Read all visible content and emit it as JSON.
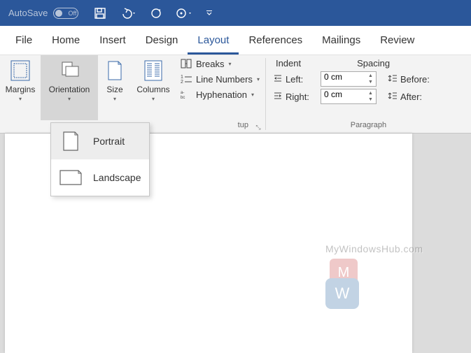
{
  "titlebar": {
    "autosave_label": "AutoSave",
    "autosave_state": "Off"
  },
  "tabs": [
    "File",
    "Home",
    "Insert",
    "Design",
    "Layout",
    "References",
    "Mailings",
    "Review"
  ],
  "active_tab": "Layout",
  "page_setup": {
    "margins": "Margins",
    "orientation": "Orientation",
    "size": "Size",
    "columns": "Columns",
    "breaks": "Breaks",
    "line_numbers": "Line Numbers",
    "hyphenation": "Hyphenation",
    "group_label": "tup"
  },
  "paragraph": {
    "indent_head": "Indent",
    "spacing_head": "Spacing",
    "left_label": "Left:",
    "right_label": "Right:",
    "before_label": "Before:",
    "after_label": "After:",
    "left_value": "0 cm",
    "right_value": "0 cm",
    "group_label": "Paragraph"
  },
  "orientation_menu": {
    "portrait": "Portrait",
    "landscape": "Landscape"
  },
  "watermark_text": "MyWindowsHub.com"
}
